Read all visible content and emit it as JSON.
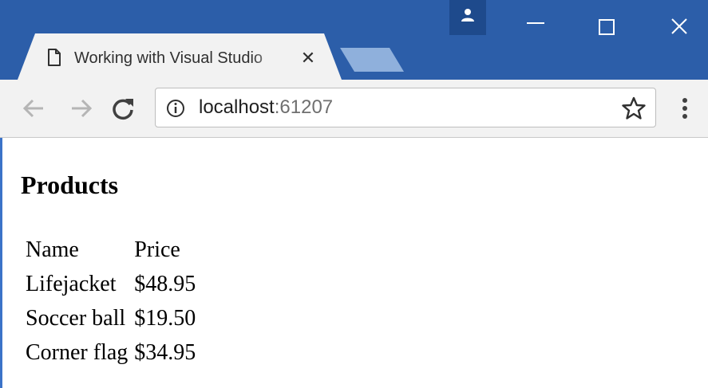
{
  "browser": {
    "tab": {
      "title": "Working with Visual Studio",
      "close_symbol": "✕"
    },
    "address_bar": {
      "host": "localhost",
      "port": ":61207"
    },
    "icons": {
      "tab_favicon": "page-icon",
      "profile": "person-icon",
      "minimize": "minimize-icon",
      "maximize": "maximize-icon",
      "close": "close-icon",
      "back": "back-arrow-icon",
      "forward": "forward-arrow-icon",
      "reload": "reload-icon",
      "site_info": "info-icon",
      "bookmark": "star-icon",
      "menu": "kebab-menu-icon"
    },
    "colors": {
      "title_bar": "#2c5ea9",
      "toolbar": "#f2f2f2",
      "inactive_tab": "#8fb0dc"
    }
  },
  "page": {
    "title": "Products",
    "table": {
      "headers": [
        "Name",
        "Price"
      ],
      "rows": [
        [
          "Lifejacket",
          "$48.95"
        ],
        [
          "Soccer ball",
          "$19.50"
        ],
        [
          "Corner flag",
          "$34.95"
        ]
      ]
    }
  }
}
